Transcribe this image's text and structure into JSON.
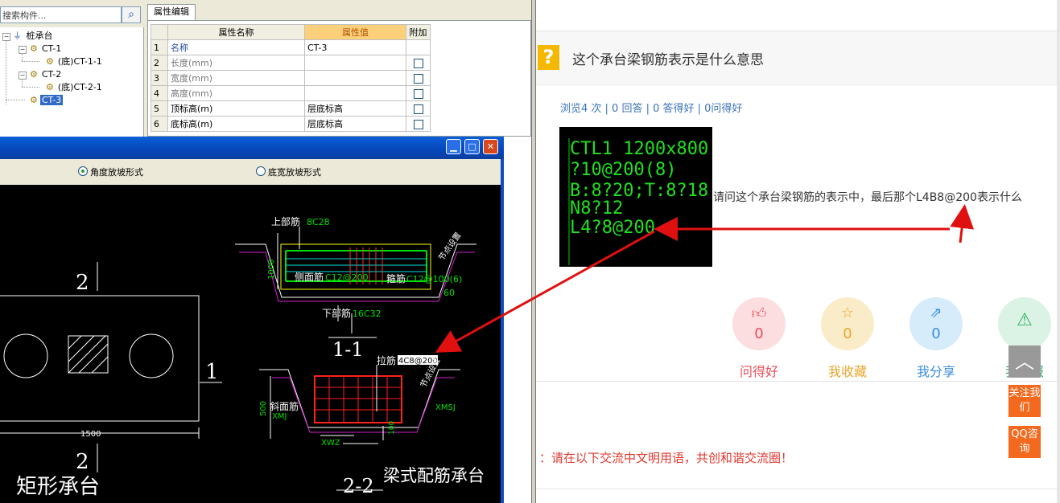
{
  "software": {
    "search_placeholder": "搜索构件...",
    "search_icon": "magnifier-icon",
    "tree": [
      {
        "label": "桩承台",
        "level": 0
      },
      {
        "label": "CT-1",
        "level": 1
      },
      {
        "label": "(底)CT-1-1",
        "level": 2
      },
      {
        "label": "CT-2",
        "level": 1
      },
      {
        "label": "(底)CT-2-1",
        "level": 2
      },
      {
        "label": "CT-3",
        "level": 1,
        "selected": true
      }
    ],
    "prop_tab": "属性编辑",
    "prop_headers": {
      "name": "属性名称",
      "value": "属性值",
      "extra": "附加"
    },
    "prop_rows": [
      {
        "num": "1",
        "name": "名称",
        "value": "CT-3",
        "has_check": false
      },
      {
        "num": "2",
        "name": "长度(mm)",
        "value": "",
        "has_check": true
      },
      {
        "num": "3",
        "name": "宽度(mm)",
        "value": "",
        "has_check": true
      },
      {
        "num": "4",
        "name": "高度(mm)",
        "value": "",
        "has_check": true
      },
      {
        "num": "5",
        "name": "顶标高(m)",
        "value": "层底标高",
        "has_check": true
      },
      {
        "num": "6",
        "name": "底标高(m)",
        "value": "层底标高",
        "has_check": true
      }
    ]
  },
  "dialog": {
    "radio_angle": "角度放坡形式",
    "radio_width": "底宽放坡形式",
    "cad": {
      "top_rebar_label": "上部筋",
      "top_rebar_value": "8C28",
      "side_rebar_label": "侧面筋",
      "side_rebar_value": "C12@200",
      "stirrup_label": "箍筋",
      "stirrup_value": "C12@100(6)",
      "angle_value": "60",
      "bottom_rebar_label": "下部筋",
      "bottom_rebar_value": "16C32",
      "height_dim": "1000",
      "section_1": "1-1",
      "tie_label": "拉筋",
      "tie_value": "4C8@200",
      "slope_label": "斜面筋",
      "xmj": "XMJ",
      "xmsj": "XMSJ",
      "xwz": "XWZ",
      "dim_500": "500",
      "dim_100": "100",
      "dim_1500": "1500",
      "section_2": "2-2",
      "plan_2a": "2",
      "plan_2b": "2",
      "plan_1": "1",
      "node_setting": "节点设置",
      "beam_title": "梁式配筋承台",
      "rect_title": "矩形承台"
    }
  },
  "web": {
    "question_title": "这个承台梁钢筋表示是什么意思",
    "stats": "浏览4 次 | 0 回答 | 0 答得好 | 0问得好",
    "image_lines": [
      "CTL1 1200x800",
      "?10@200(8)",
      "B:8?20;T:8?18",
      "N8?12",
      "L4?8@200"
    ],
    "question_text": "请问这个承台梁钢筋的表示中，最后那个L4B8@200表示什么",
    "actions": [
      {
        "label": "问得好",
        "count": "0",
        "icon": "thumbs-up-icon",
        "bg": "#fcdde0",
        "color": "#e8505b"
      },
      {
        "label": "我收藏",
        "count": "0",
        "icon": "star-icon",
        "bg": "#fbecc9",
        "color": "#e8a52c"
      },
      {
        "label": "我分享",
        "count": "0",
        "icon": "share-icon",
        "bg": "#d6ecfb",
        "color": "#3a8de0"
      },
      {
        "label": "我举报",
        "count": "",
        "icon": "warning-icon",
        "bg": "#daf3e4",
        "color": "#30b060"
      }
    ],
    "civil_notice": "：请在以下交流中文明用语，共创和谐交流圈！",
    "follow_btn": "关注我们",
    "qq_btn": "QQ咨询"
  }
}
